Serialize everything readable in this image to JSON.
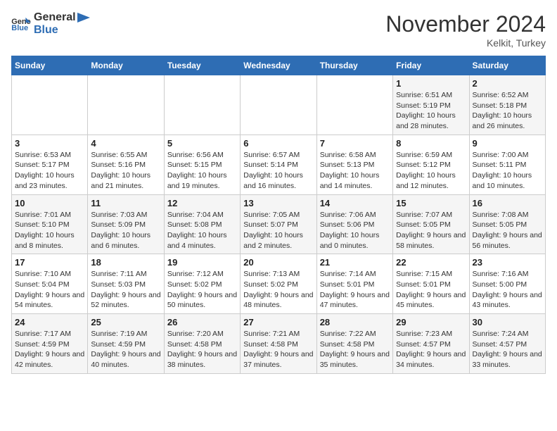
{
  "header": {
    "logo_general": "General",
    "logo_blue": "Blue",
    "month_title": "November 2024",
    "location": "Kelkit, Turkey"
  },
  "weekdays": [
    "Sunday",
    "Monday",
    "Tuesday",
    "Wednesday",
    "Thursday",
    "Friday",
    "Saturday"
  ],
  "weeks": [
    [
      {
        "day": "",
        "info": ""
      },
      {
        "day": "",
        "info": ""
      },
      {
        "day": "",
        "info": ""
      },
      {
        "day": "",
        "info": ""
      },
      {
        "day": "",
        "info": ""
      },
      {
        "day": "1",
        "info": "Sunrise: 6:51 AM\nSunset: 5:19 PM\nDaylight: 10 hours and 28 minutes."
      },
      {
        "day": "2",
        "info": "Sunrise: 6:52 AM\nSunset: 5:18 PM\nDaylight: 10 hours and 26 minutes."
      }
    ],
    [
      {
        "day": "3",
        "info": "Sunrise: 6:53 AM\nSunset: 5:17 PM\nDaylight: 10 hours and 23 minutes."
      },
      {
        "day": "4",
        "info": "Sunrise: 6:55 AM\nSunset: 5:16 PM\nDaylight: 10 hours and 21 minutes."
      },
      {
        "day": "5",
        "info": "Sunrise: 6:56 AM\nSunset: 5:15 PM\nDaylight: 10 hours and 19 minutes."
      },
      {
        "day": "6",
        "info": "Sunrise: 6:57 AM\nSunset: 5:14 PM\nDaylight: 10 hours and 16 minutes."
      },
      {
        "day": "7",
        "info": "Sunrise: 6:58 AM\nSunset: 5:13 PM\nDaylight: 10 hours and 14 minutes."
      },
      {
        "day": "8",
        "info": "Sunrise: 6:59 AM\nSunset: 5:12 PM\nDaylight: 10 hours and 12 minutes."
      },
      {
        "day": "9",
        "info": "Sunrise: 7:00 AM\nSunset: 5:11 PM\nDaylight: 10 hours and 10 minutes."
      }
    ],
    [
      {
        "day": "10",
        "info": "Sunrise: 7:01 AM\nSunset: 5:10 PM\nDaylight: 10 hours and 8 minutes."
      },
      {
        "day": "11",
        "info": "Sunrise: 7:03 AM\nSunset: 5:09 PM\nDaylight: 10 hours and 6 minutes."
      },
      {
        "day": "12",
        "info": "Sunrise: 7:04 AM\nSunset: 5:08 PM\nDaylight: 10 hours and 4 minutes."
      },
      {
        "day": "13",
        "info": "Sunrise: 7:05 AM\nSunset: 5:07 PM\nDaylight: 10 hours and 2 minutes."
      },
      {
        "day": "14",
        "info": "Sunrise: 7:06 AM\nSunset: 5:06 PM\nDaylight: 10 hours and 0 minutes."
      },
      {
        "day": "15",
        "info": "Sunrise: 7:07 AM\nSunset: 5:05 PM\nDaylight: 9 hours and 58 minutes."
      },
      {
        "day": "16",
        "info": "Sunrise: 7:08 AM\nSunset: 5:05 PM\nDaylight: 9 hours and 56 minutes."
      }
    ],
    [
      {
        "day": "17",
        "info": "Sunrise: 7:10 AM\nSunset: 5:04 PM\nDaylight: 9 hours and 54 minutes."
      },
      {
        "day": "18",
        "info": "Sunrise: 7:11 AM\nSunset: 5:03 PM\nDaylight: 9 hours and 52 minutes."
      },
      {
        "day": "19",
        "info": "Sunrise: 7:12 AM\nSunset: 5:02 PM\nDaylight: 9 hours and 50 minutes."
      },
      {
        "day": "20",
        "info": "Sunrise: 7:13 AM\nSunset: 5:02 PM\nDaylight: 9 hours and 48 minutes."
      },
      {
        "day": "21",
        "info": "Sunrise: 7:14 AM\nSunset: 5:01 PM\nDaylight: 9 hours and 47 minutes."
      },
      {
        "day": "22",
        "info": "Sunrise: 7:15 AM\nSunset: 5:01 PM\nDaylight: 9 hours and 45 minutes."
      },
      {
        "day": "23",
        "info": "Sunrise: 7:16 AM\nSunset: 5:00 PM\nDaylight: 9 hours and 43 minutes."
      }
    ],
    [
      {
        "day": "24",
        "info": "Sunrise: 7:17 AM\nSunset: 4:59 PM\nDaylight: 9 hours and 42 minutes."
      },
      {
        "day": "25",
        "info": "Sunrise: 7:19 AM\nSunset: 4:59 PM\nDaylight: 9 hours and 40 minutes."
      },
      {
        "day": "26",
        "info": "Sunrise: 7:20 AM\nSunset: 4:58 PM\nDaylight: 9 hours and 38 minutes."
      },
      {
        "day": "27",
        "info": "Sunrise: 7:21 AM\nSunset: 4:58 PM\nDaylight: 9 hours and 37 minutes."
      },
      {
        "day": "28",
        "info": "Sunrise: 7:22 AM\nSunset: 4:58 PM\nDaylight: 9 hours and 35 minutes."
      },
      {
        "day": "29",
        "info": "Sunrise: 7:23 AM\nSunset: 4:57 PM\nDaylight: 9 hours and 34 minutes."
      },
      {
        "day": "30",
        "info": "Sunrise: 7:24 AM\nSunset: 4:57 PM\nDaylight: 9 hours and 33 minutes."
      }
    ]
  ]
}
